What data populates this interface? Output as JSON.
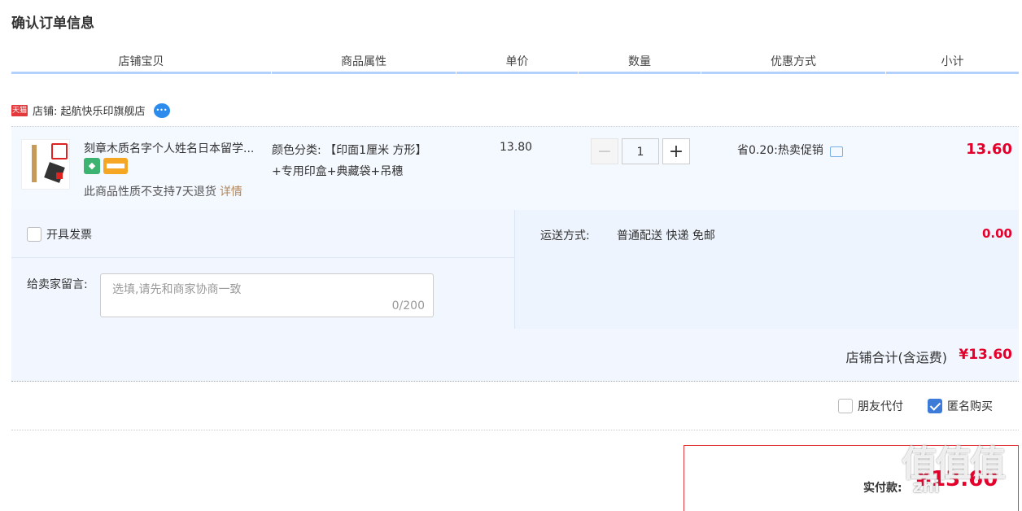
{
  "page_title": "确认订单信息",
  "columns": [
    "店铺宝贝",
    "商品属性",
    "单价",
    "数量",
    "优惠方式",
    "小计"
  ],
  "shop": {
    "badge": "天猫",
    "name": "店铺: 起航快乐印旗舰店"
  },
  "item": {
    "name": "刻章木质名字个人姓名日本留学...",
    "notice": "此商品性质不支持7天退货",
    "notice_link": "详情",
    "property_line1": "颜色分类: 【印面1厘米 方形】",
    "property_line2": "+专用印盒+典藏袋+吊穗",
    "unit_price": "13.80",
    "quantity": "1",
    "minus": "−",
    "plus": "+",
    "promotion": "省0.20:热卖促销",
    "subtotal": "13.60"
  },
  "options": {
    "invoice_label": "开具发票",
    "message_label": "给卖家留言:",
    "message_placeholder": "选填,请先和商家协商一致",
    "message_counter": "0/200",
    "shipping_label": "运送方式:",
    "shipping_value": "普通配送 快递 免邮",
    "shipping_fee": "0.00"
  },
  "totals": {
    "shop_total_label": "店铺合计(含运费)",
    "shop_total_value": "¥13.60"
  },
  "extras": {
    "friend_pay_label": "朋友代付",
    "anonymous_label": "匿名购买"
  },
  "payment": {
    "label": "实付款:",
    "value": "¥13.60"
  },
  "watermark": {
    "text": "值值值",
    "domain": "zhi"
  },
  "colors": {
    "accent_red": "#e4002b",
    "header_border": "#b2d1ff",
    "row_bg": "#f4f8ff"
  }
}
